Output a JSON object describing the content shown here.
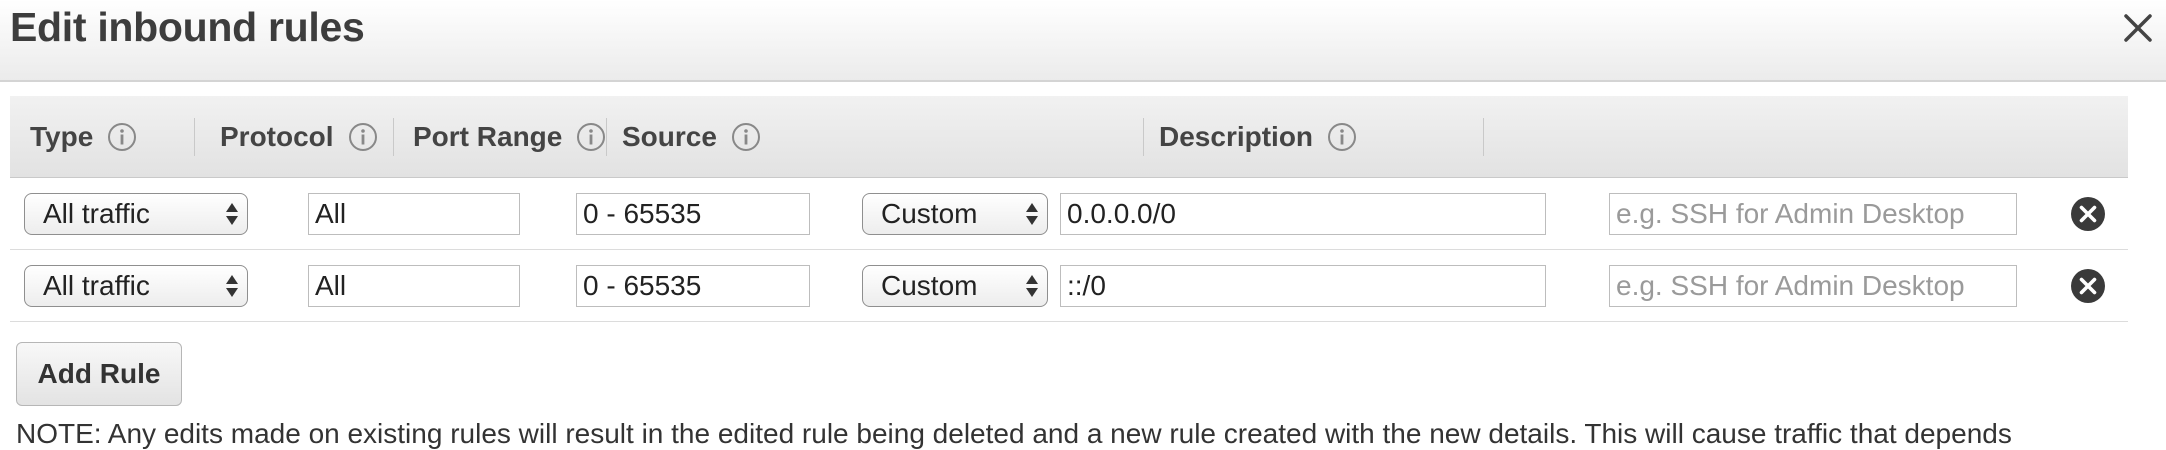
{
  "modal": {
    "title": "Edit inbound rules",
    "close_icon": "close-icon"
  },
  "table": {
    "headers": [
      {
        "label": "Type",
        "icon": "info-icon"
      },
      {
        "label": "Protocol",
        "icon": "info-icon"
      },
      {
        "label": "Port Range",
        "icon": "info-icon"
      },
      {
        "label": "Source",
        "icon": "info-icon"
      },
      {
        "label": "Description",
        "icon": "info-icon"
      }
    ],
    "rows": [
      {
        "type": "All traffic",
        "protocol": "All",
        "port_range": "0 - 65535",
        "source_type": "Custom",
        "source_value": "0.0.0.0/0",
        "description_placeholder": "e.g. SSH for Admin Desktop"
      },
      {
        "type": "All traffic",
        "protocol": "All",
        "port_range": "0 - 65535",
        "source_type": "Custom",
        "source_value": "::/0",
        "description_placeholder": "e.g. SSH for Admin Desktop"
      }
    ],
    "remove_icon": "remove-circle-icon"
  },
  "actions": {
    "add_rule_label": "Add Rule"
  },
  "note": "NOTE: Any edits made on existing rules will result in the edited rule being deleted and a new rule created with the new details. This will cause traffic that depends"
}
